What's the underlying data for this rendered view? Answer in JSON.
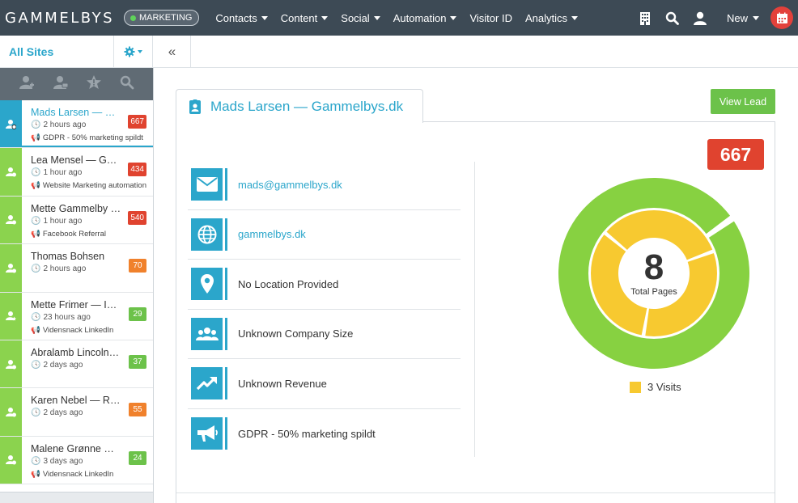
{
  "header": {
    "logo": "GAMMELBYS",
    "mode_badge": "MARKETING",
    "menu": [
      {
        "label": "Contacts"
      },
      {
        "label": "Content"
      },
      {
        "label": "Social"
      },
      {
        "label": "Automation"
      },
      {
        "label": "Visitor ID"
      },
      {
        "label": "Analytics"
      }
    ],
    "new_label": "New"
  },
  "subbar": {
    "all_sites": "All Sites",
    "collapse_glyph": "«"
  },
  "sidebar": {
    "leads": [
      {
        "name": "Mads Larsen — Gammelbys.dk",
        "time": "2 hours ago",
        "source": "GDPR - 50% marketing spildt",
        "score": "667",
        "color": "#e0432f"
      },
      {
        "name": "Lea Mensel — Gammelbys",
        "time": "1 hour ago",
        "source": "Website Marketing automation",
        "score": "434",
        "color": "#e0432f"
      },
      {
        "name": "Mette Gammelby — Gammelbys",
        "time": "1 hour ago",
        "source": "Facebook Referral",
        "score": "540",
        "color": "#e0432f"
      },
      {
        "name": "Thomas Bohsen",
        "time": "2 hours ago",
        "source": "",
        "score": "70",
        "color": "#f0812c"
      },
      {
        "name": "Mette Frimer — Intern",
        "time": "23 hours ago",
        "source": "Vidensnack LinkedIn",
        "score": "29",
        "color": "#6cc24a"
      },
      {
        "name": "Abralamb Lincoln — US",
        "time": "2 days ago",
        "source": "",
        "score": "37",
        "color": "#6cc24a"
      },
      {
        "name": "Karen Nebel — RIP Bureau",
        "time": "2 days ago",
        "source": "",
        "score": "55",
        "color": "#f0812c"
      },
      {
        "name": "Malene Grønne — Studio",
        "time": "3 days ago",
        "source": "Vidensnack LinkedIn",
        "score": "24",
        "color": "#6cc24a"
      }
    ]
  },
  "main": {
    "tab_title": "Mads Larsen — Gammelbys.dk",
    "view_lead": "View Lead",
    "points": "667",
    "info": {
      "email": "mads@gammelbys.dk",
      "website": "gammelbys.dk",
      "location": "No Location Provided",
      "company_size": "Unknown Company Size",
      "revenue": "Unknown Revenue",
      "campaign": "GDPR - 50% marketing spildt"
    },
    "donut": {
      "total": "8",
      "total_label": "Total Pages",
      "legend": "3 Visits",
      "inner_color": "#f7c930",
      "outer_color": "#87d141",
      "inner_segments": 3
    }
  }
}
